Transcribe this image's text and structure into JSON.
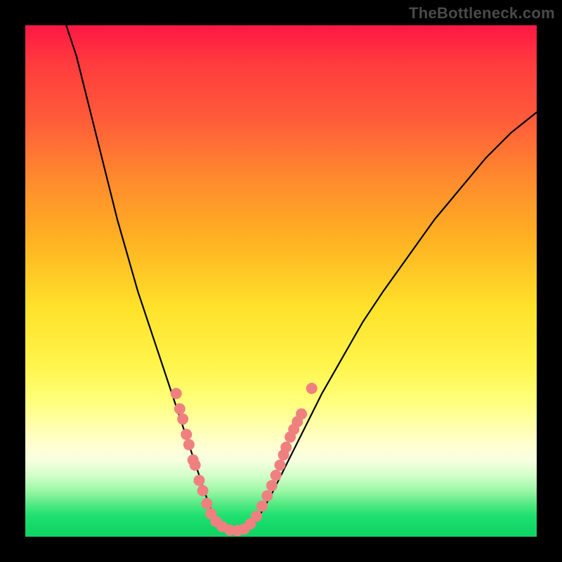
{
  "watermark": "TheBottleneck.com",
  "chart_data": {
    "type": "line",
    "title": "",
    "xlabel": "",
    "ylabel": "",
    "xlim": [
      0,
      100
    ],
    "ylim": [
      0,
      100
    ],
    "series": [
      {
        "name": "curve",
        "x": [
          8,
          10,
          12,
          14,
          16,
          18,
          20,
          22,
          24,
          26,
          28,
          30,
          32,
          34,
          35,
          36,
          37,
          38,
          39,
          40,
          41,
          42,
          43,
          44,
          45,
          46,
          48,
          50,
          52,
          55,
          58,
          62,
          66,
          70,
          75,
          80,
          85,
          90,
          95,
          100
        ],
        "y": [
          100,
          94,
          86,
          78,
          70,
          62,
          55,
          48,
          42,
          36,
          30,
          24,
          18,
          12,
          9,
          6,
          4,
          3,
          2,
          1.5,
          1.2,
          1.1,
          1.3,
          2,
          3,
          4.5,
          8,
          12,
          16,
          22,
          28,
          35,
          42,
          48,
          55,
          62,
          68,
          74,
          79,
          83
        ]
      }
    ],
    "markers": [
      {
        "x": 29.5,
        "y": 28
      },
      {
        "x": 30.2,
        "y": 25
      },
      {
        "x": 30.8,
        "y": 23
      },
      {
        "x": 31.5,
        "y": 20
      },
      {
        "x": 32.0,
        "y": 18
      },
      {
        "x": 32.8,
        "y": 15
      },
      {
        "x": 33.2,
        "y": 14
      },
      {
        "x": 34.0,
        "y": 11
      },
      {
        "x": 34.7,
        "y": 9
      },
      {
        "x": 35.5,
        "y": 6.5
      },
      {
        "x": 36.3,
        "y": 4.5
      },
      {
        "x": 37.3,
        "y": 3
      },
      {
        "x": 38.5,
        "y": 2
      },
      {
        "x": 40.0,
        "y": 1.3
      },
      {
        "x": 41.5,
        "y": 1.2
      },
      {
        "x": 42.8,
        "y": 1.5
      },
      {
        "x": 44.0,
        "y": 2.5
      },
      {
        "x": 45.2,
        "y": 4
      },
      {
        "x": 46.3,
        "y": 6
      },
      {
        "x": 47.3,
        "y": 8
      },
      {
        "x": 48.2,
        "y": 10
      },
      {
        "x": 49.0,
        "y": 12
      },
      {
        "x": 49.8,
        "y": 14
      },
      {
        "x": 50.5,
        "y": 16
      },
      {
        "x": 51.0,
        "y": 17.5
      },
      {
        "x": 51.8,
        "y": 19.5
      },
      {
        "x": 52.5,
        "y": 21
      },
      {
        "x": 53.2,
        "y": 22.5
      },
      {
        "x": 54.0,
        "y": 24
      },
      {
        "x": 56.0,
        "y": 29
      }
    ],
    "marker_color": "#f08080",
    "curve_color": "#000000",
    "band_start_y": 0,
    "band_end_y": 2
  }
}
